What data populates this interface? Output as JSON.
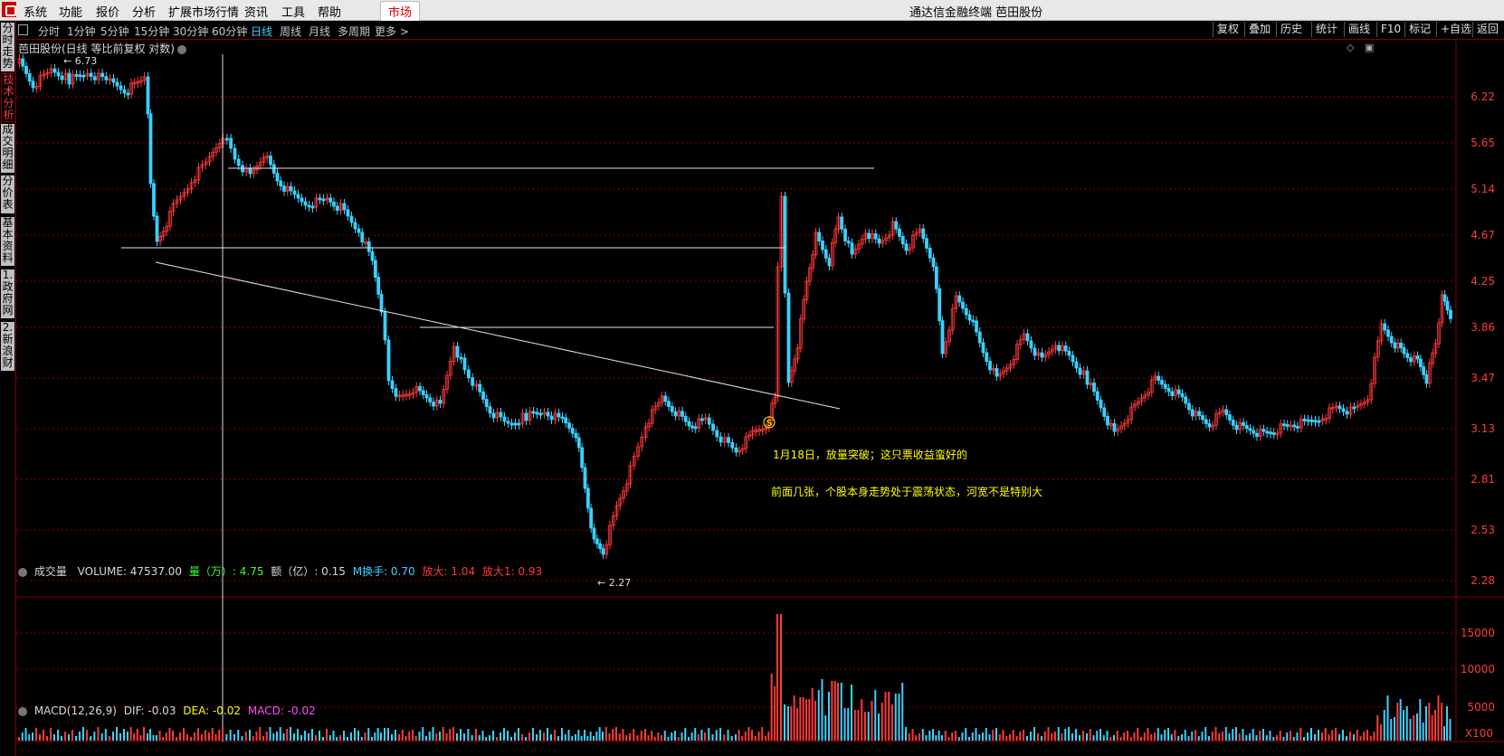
{
  "menu": {
    "items": [
      "系统",
      "功能",
      "报价",
      "分析",
      "扩展市场行情",
      "资讯",
      "工具",
      "帮助"
    ],
    "market_tab": "市场",
    "window_title": "通达信金融终端  芭田股份"
  },
  "toolbar": {
    "periods": [
      "分时",
      "1分钟",
      "5分钟",
      "15分钟",
      "30分钟",
      "60分钟",
      "日线",
      "周线",
      "月线",
      "多周期",
      "更多 >"
    ],
    "active_period": "日线",
    "right_buttons": [
      "复权",
      "叠加",
      "历史",
      "统计",
      "画线",
      "F10",
      "标记",
      "+自选",
      "返回"
    ]
  },
  "left_tabs": [
    {
      "label": "分时走势",
      "active": false
    },
    {
      "label": "技术分析",
      "active": true
    },
    {
      "label": "成交明细",
      "active": false
    },
    {
      "label": "分价表",
      "active": false
    },
    {
      "label": "基本资料",
      "active": false
    },
    {
      "label": "1.政府网",
      "active": false
    },
    {
      "label": "2.新浪财",
      "active": false
    }
  ],
  "chart": {
    "title": "芭田股份(日线 等比前复权 对数)",
    "price_axis": [
      "6.22",
      "5.65",
      "5.14",
      "4.67",
      "4.25",
      "3.86",
      "3.47",
      "3.13",
      "2.81",
      "2.53",
      "2.28"
    ],
    "high_marker": "6.73",
    "low_marker": "2.27",
    "signal_marker": "S",
    "annotations": [
      "1月18日，放量突破；这只票收益蛮好的",
      "前面几张，个股本身走势处于震荡状态，河宽不是特别大"
    ],
    "colors": {
      "up": "#ff3a3a",
      "down": "#3ad1ff",
      "grid": "#8b0000",
      "annotation": "#ffff00",
      "axis_label": "#ff3a3a"
    }
  },
  "volume": {
    "indicator": "成交量",
    "volume_text": "VOLUME: 47537.00",
    "qty_label": "量（万）",
    "qty_value": ": 4.75",
    "amt_label": "额（亿）",
    "amt_value": ": 0.15",
    "turnover_label": "M换手",
    "turnover_value": ": 0.70",
    "amp_label": "放大",
    "amp_value": ": 1.04",
    "amp1_label": "放大1",
    "amp1_value": ": 0.93",
    "axis": [
      "15000",
      "10000",
      "5000"
    ],
    "unit": "X100"
  },
  "macd": {
    "label": "MACD(12,26,9)",
    "dif": "DIF: -0.03",
    "dea": "DEA: -0.02",
    "macd_val": "MACD: -0.02"
  }
}
